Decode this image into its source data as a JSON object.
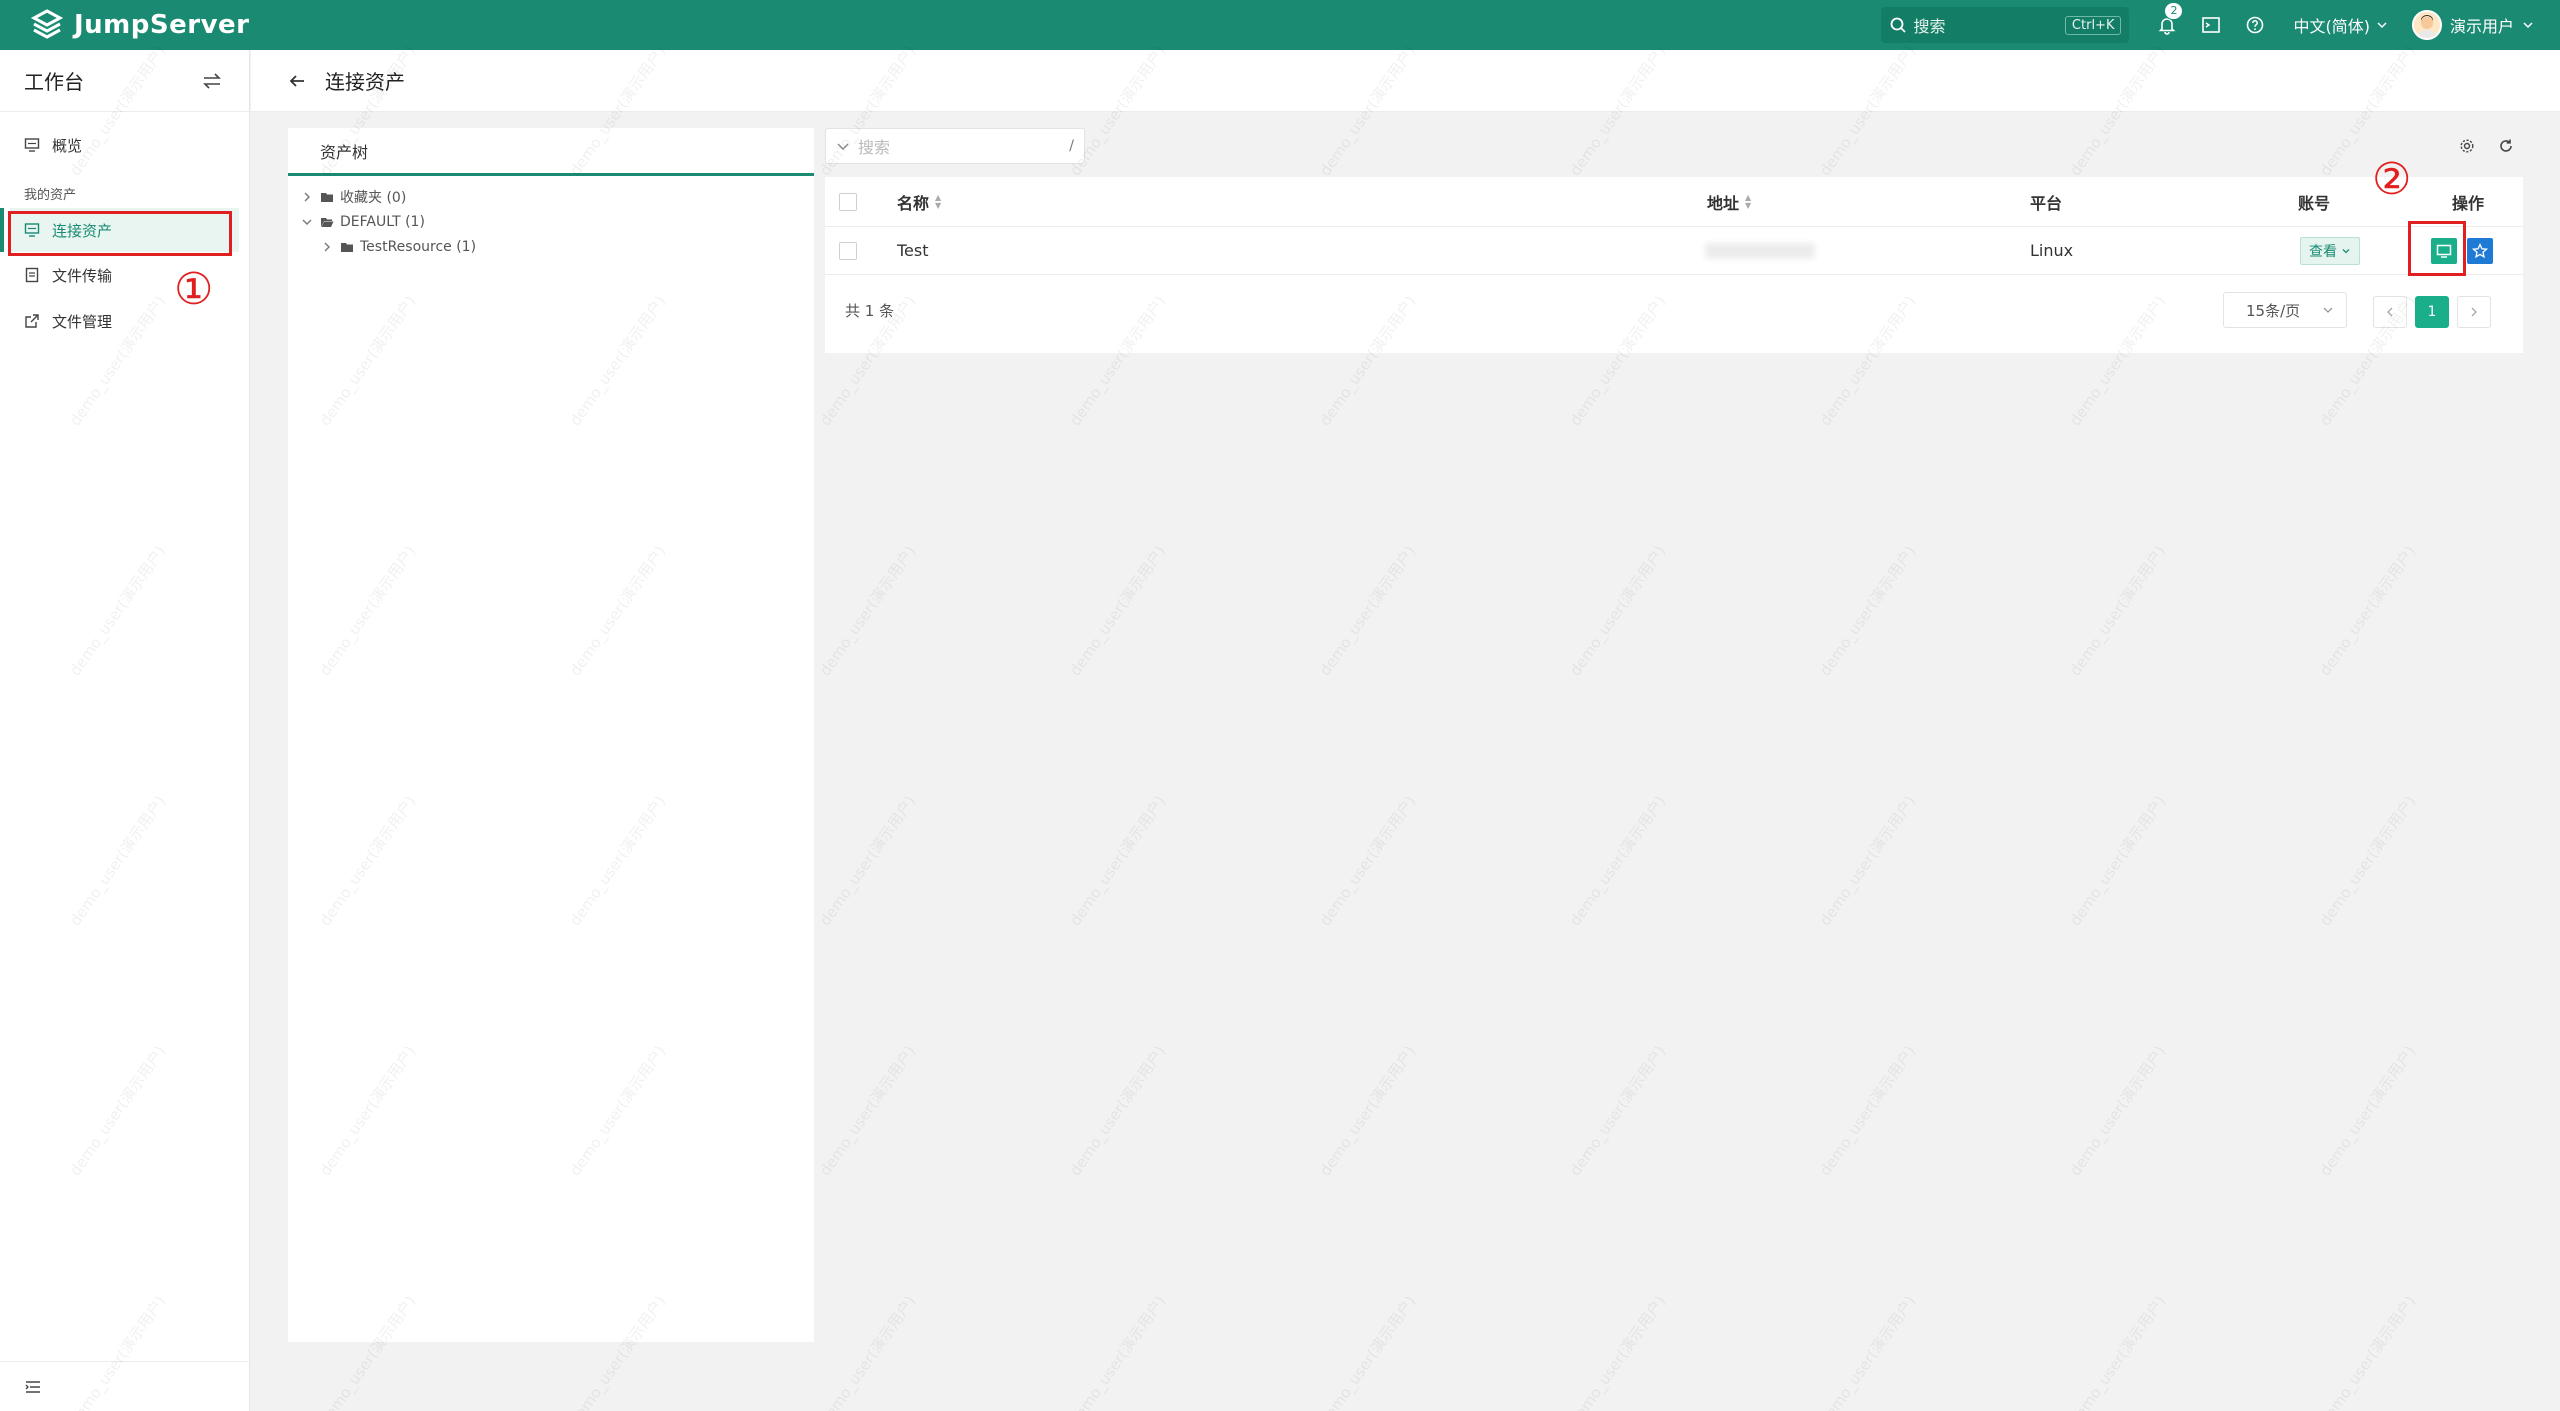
{
  "app": {
    "brand": "JumpServer",
    "accent": "#1a8b72"
  },
  "topbar": {
    "search_placeholder": "搜索",
    "search_shortcut": "Ctrl+K",
    "notification_count": "2",
    "language": "中文(简体)",
    "username": "演示用户"
  },
  "sidebar": {
    "title": "工作台",
    "items": [
      {
        "label": "概览",
        "icon": "monitor-icon"
      },
      {
        "label": "我的资产",
        "group": true
      },
      {
        "label": "连接资产",
        "icon": "monitor-icon",
        "active": true
      },
      {
        "label": "文件传输",
        "icon": "file-icon"
      },
      {
        "label": "文件管理",
        "icon": "external-link-icon"
      }
    ]
  },
  "page": {
    "title": "连接资产"
  },
  "tree": {
    "tab": "资产树",
    "nodes": [
      {
        "label": "收藏夹 (0)",
        "level": 0,
        "expanded": false
      },
      {
        "label": "DEFAULT (1)",
        "level": 0,
        "expanded": true
      },
      {
        "label": "TestResource (1)",
        "level": 1,
        "expanded": false
      }
    ]
  },
  "table": {
    "search_placeholder": "搜索",
    "search_shortcut": "/",
    "columns": {
      "name": "名称",
      "address": "地址",
      "platform": "平台",
      "account": "账号",
      "actions": "操作"
    },
    "rows": [
      {
        "name": "Test",
        "address": "(blurred)",
        "platform": "Linux",
        "account_btn": "查看"
      }
    ],
    "total": "共 1 条",
    "page_size": "15条/页",
    "current_page": "1"
  },
  "annotations": {
    "marker1": "①",
    "marker2": "②"
  },
  "watermark_text": "demo_user(演示用户)"
}
